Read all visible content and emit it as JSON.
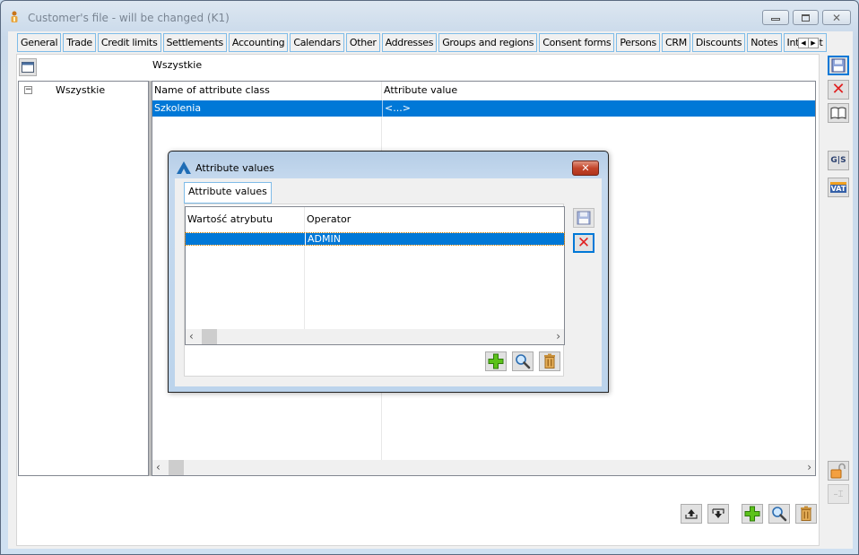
{
  "window": {
    "title": "Customer's file - will be changed (K1)",
    "controls": {
      "minimize": "minimize",
      "maximize": "maximize",
      "close": "close"
    }
  },
  "tabs": [
    {
      "label": "General"
    },
    {
      "label": "Trade"
    },
    {
      "label": "Credit limits"
    },
    {
      "label": "Settlements"
    },
    {
      "label": "Accounting"
    },
    {
      "label": "Calendars"
    },
    {
      "label": "Other"
    },
    {
      "label": "Addresses"
    },
    {
      "label": "Groups and regions"
    },
    {
      "label": "Consent forms"
    },
    {
      "label": "Persons"
    },
    {
      "label": "CRM"
    },
    {
      "label": "Discounts"
    },
    {
      "label": "Notes"
    },
    {
      "label": "Interest"
    }
  ],
  "filter": {
    "label": "Wszystkie"
  },
  "tree": {
    "items": [
      {
        "label": "Wszystkie",
        "expanded": true
      }
    ]
  },
  "grid": {
    "columns": [
      "Name of attribute class",
      "Attribute value"
    ],
    "rows": [
      {
        "class_name": "Szkolenia",
        "value": "<...>",
        "selected": true
      }
    ]
  },
  "dialog": {
    "title": "Attribute values",
    "tab": "Attribute values",
    "columns": [
      "Wartość atrybutu",
      "Operator"
    ],
    "rows": [
      {
        "value": "",
        "operator": "ADMIN",
        "selected": true
      }
    ]
  },
  "sidebar": {
    "buttons": [
      "save",
      "cancel",
      "book",
      "gus",
      "vat"
    ]
  },
  "bottom_buttons": [
    "export",
    "import",
    "add",
    "view",
    "delete"
  ],
  "colors": {
    "selection": "#0078d7",
    "tab_border": "#7fbce8",
    "accent_green": "#4caf1a",
    "delete_red": "#e02020"
  }
}
